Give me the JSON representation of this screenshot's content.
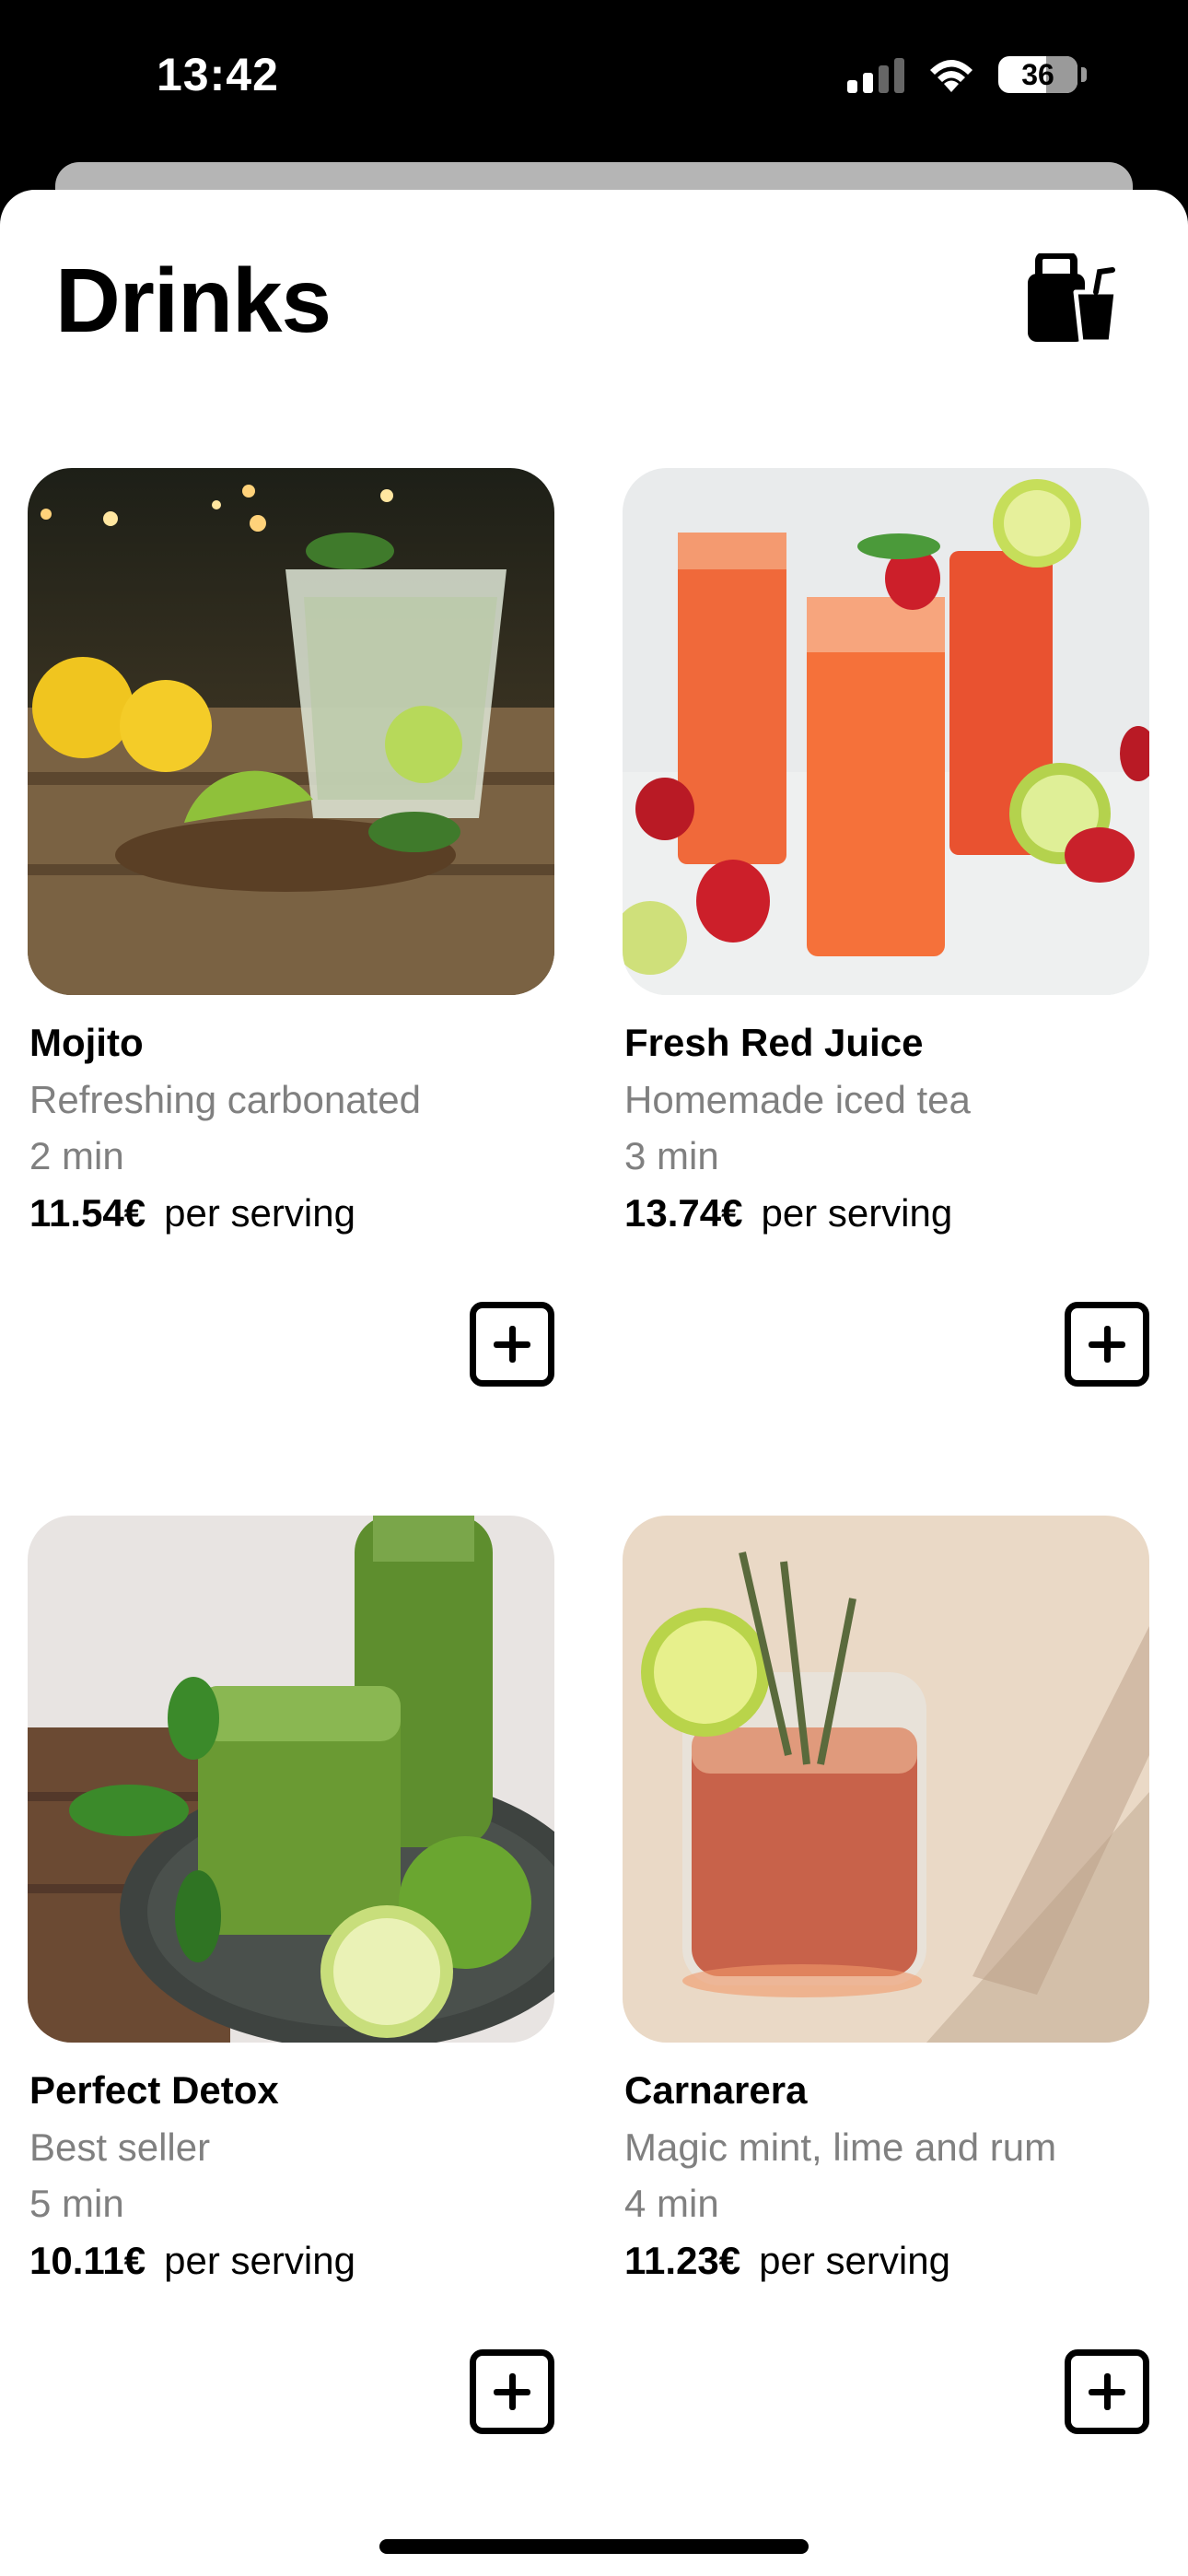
{
  "status": {
    "time": "13:42",
    "battery": "36"
  },
  "header": {
    "title": "Drinks"
  },
  "products": [
    {
      "name": "Mojito",
      "description": "Refreshing carbonated",
      "time": "2 min",
      "price": "11.54€",
      "unit": "per serving"
    },
    {
      "name": "Fresh Red Juice",
      "description": "Homemade iced tea",
      "time": "3 min",
      "price": "13.74€",
      "unit": "per serving"
    },
    {
      "name": "Perfect Detox",
      "description": "Best seller",
      "time": "5 min",
      "price": "10.11€",
      "unit": "per serving"
    },
    {
      "name": "Carnarera",
      "description": "Magic mint, lime and rum",
      "time": "4 min",
      "price": "11.23€",
      "unit": "per serving"
    }
  ]
}
